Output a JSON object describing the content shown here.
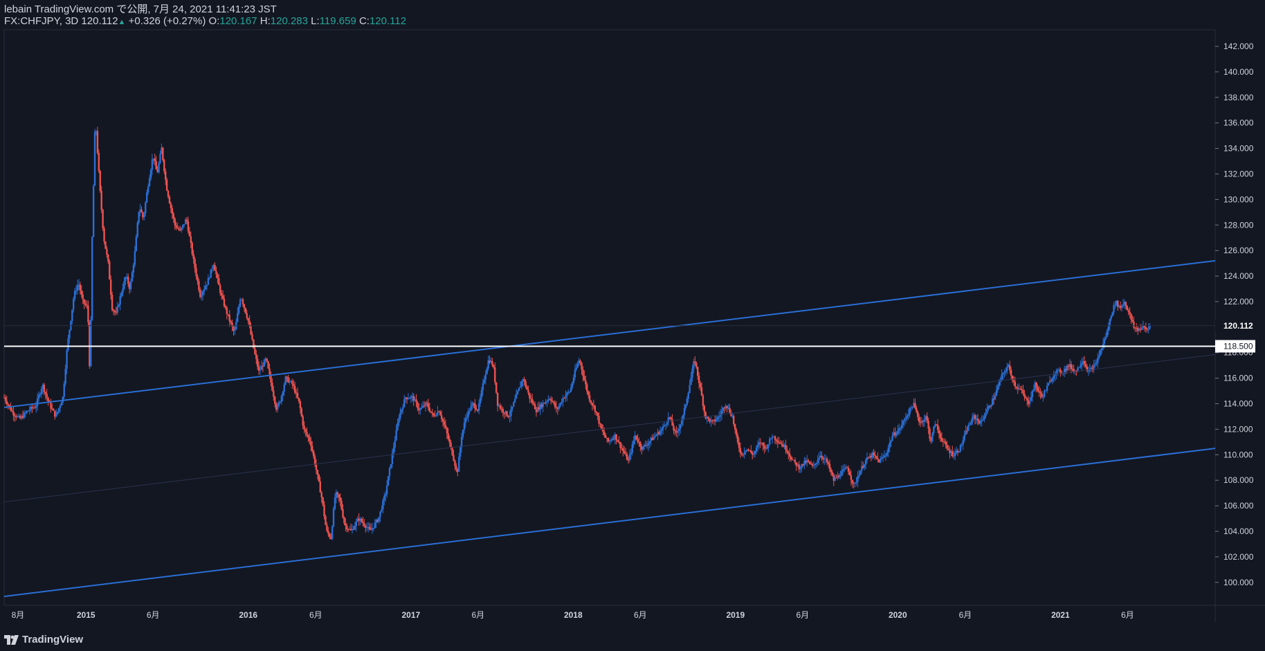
{
  "header": {
    "line1": "lebain TradingView.com で公開, 7月 24, 2021 11:41:23 JST",
    "symbol": "FX:CHFJPY, 3D",
    "last": "120.112",
    "up_arrow": "▲",
    "change": "+0.326 (+0.27%)",
    "o_label": "O:",
    "o_value": "120.167",
    "h_label": "H:",
    "h_value": "120.283",
    "l_label": "L:",
    "l_value": "119.659",
    "c_label": "C:",
    "c_value": "120.112"
  },
  "brand": {
    "name": "TradingView",
    "icon": "tradingview-logo-icon"
  },
  "colors": {
    "background": "#131722",
    "up": "#2a6fd6",
    "down": "#ef5350",
    "channel": "#2a6fd6",
    "level": "#ffffff"
  },
  "chart_data": {
    "type": "candlestick",
    "symbol": "FX:CHFJPY",
    "interval": "3D",
    "ylim": [
      98.2,
      143.3
    ],
    "y_ticks": [
      "142.000",
      "140.000",
      "138.000",
      "136.000",
      "134.000",
      "132.000",
      "130.000",
      "128.000",
      "126.000",
      "124.000",
      "122.000",
      "120.000",
      "118.000",
      "116.000",
      "114.000",
      "112.000",
      "110.000",
      "108.000",
      "106.000",
      "104.000",
      "102.000",
      "100.000"
    ],
    "x_labels": [
      "8月",
      "2015",
      "6月",
      "2016",
      "6月",
      "2017",
      "6月",
      "2018",
      "6月",
      "2019",
      "6月",
      "2020",
      "6月",
      "2021",
      "6月"
    ],
    "x_label_dates": [
      "2014-08-01",
      "2015-01-01",
      "2015-06-01",
      "2016-01-01",
      "2016-06-01",
      "2017-01-01",
      "2017-06-01",
      "2018-01-01",
      "2018-06-01",
      "2019-01-01",
      "2019-06-01",
      "2020-01-01",
      "2020-06-01",
      "2021-01-01",
      "2021-06-01"
    ],
    "x_range": [
      "2014-07-01",
      "2021-12-15"
    ],
    "close_path": [
      [
        "2014-07-01",
        114.5
      ],
      [
        "2014-07-20",
        113.3
      ],
      [
        "2014-08-05",
        112.8
      ],
      [
        "2014-08-25",
        113.5
      ],
      [
        "2014-09-10",
        113.8
      ],
      [
        "2014-09-25",
        115.5
      ],
      [
        "2014-10-10",
        114.0
      ],
      [
        "2014-10-25",
        113.0
      ],
      [
        "2014-11-10",
        114.5
      ],
      [
        "2014-11-20",
        118.5
      ],
      [
        "2014-12-05",
        122.5
      ],
      [
        "2014-12-15",
        123.5
      ],
      [
        "2014-12-25",
        122.0
      ],
      [
        "2015-01-05",
        121.5
      ],
      [
        "2015-01-10",
        116.0
      ],
      [
        "2015-01-15",
        127.0
      ],
      [
        "2015-01-22",
        136.5
      ],
      [
        "2015-02-01",
        131.0
      ],
      [
        "2015-02-10",
        127.0
      ],
      [
        "2015-02-20",
        125.0
      ],
      [
        "2015-03-01",
        121.5
      ],
      [
        "2015-03-10",
        121.0
      ],
      [
        "2015-03-20",
        122.5
      ],
      [
        "2015-04-01",
        124.0
      ],
      [
        "2015-04-10",
        123.0
      ],
      [
        "2015-04-20",
        125.5
      ],
      [
        "2015-05-01",
        129.5
      ],
      [
        "2015-05-10",
        128.5
      ],
      [
        "2015-05-20",
        131.0
      ],
      [
        "2015-06-01",
        133.5
      ],
      [
        "2015-06-10",
        132.0
      ],
      [
        "2015-06-20",
        134.0
      ],
      [
        "2015-07-01",
        131.0
      ],
      [
        "2015-07-10",
        129.5
      ],
      [
        "2015-07-20",
        128.0
      ],
      [
        "2015-08-01",
        127.5
      ],
      [
        "2015-08-15",
        128.5
      ],
      [
        "2015-09-01",
        125.0
      ],
      [
        "2015-09-15",
        122.5
      ],
      [
        "2015-10-01",
        123.5
      ],
      [
        "2015-10-15",
        125.0
      ],
      [
        "2015-11-01",
        122.5
      ],
      [
        "2015-11-15",
        121.0
      ],
      [
        "2015-12-01",
        119.5
      ],
      [
        "2015-12-15",
        122.5
      ],
      [
        "2016-01-01",
        120.5
      ],
      [
        "2016-01-15",
        118.0
      ],
      [
        "2016-01-25",
        116.5
      ],
      [
        "2016-02-10",
        117.5
      ],
      [
        "2016-02-25",
        115.0
      ],
      [
        "2016-03-05",
        113.5
      ],
      [
        "2016-03-15",
        114.5
      ],
      [
        "2016-03-25",
        116.0
      ],
      [
        "2016-04-10",
        115.5
      ],
      [
        "2016-04-25",
        114.0
      ],
      [
        "2016-05-05",
        112.0
      ],
      [
        "2016-05-20",
        111.0
      ],
      [
        "2016-06-01",
        109.0
      ],
      [
        "2016-06-15",
        106.5
      ],
      [
        "2016-06-25",
        104.0
      ],
      [
        "2016-07-05",
        103.5
      ],
      [
        "2016-07-15",
        107.0
      ],
      [
        "2016-07-25",
        106.5
      ],
      [
        "2016-08-05",
        104.5
      ],
      [
        "2016-08-20",
        104.0
      ],
      [
        "2016-09-05",
        105.0
      ],
      [
        "2016-09-20",
        104.5
      ],
      [
        "2016-10-01",
        104.0
      ],
      [
        "2016-10-20",
        105.0
      ],
      [
        "2016-11-05",
        107.0
      ],
      [
        "2016-11-20",
        110.0
      ],
      [
        "2016-12-05",
        113.0
      ],
      [
        "2016-12-20",
        114.5
      ],
      [
        "2017-01-05",
        114.5
      ],
      [
        "2017-01-20",
        113.5
      ],
      [
        "2017-02-05",
        114.0
      ],
      [
        "2017-02-20",
        113.0
      ],
      [
        "2017-03-05",
        113.5
      ],
      [
        "2017-03-20",
        112.0
      ],
      [
        "2017-04-05",
        110.0
      ],
      [
        "2017-04-15",
        108.5
      ],
      [
        "2017-04-25",
        111.5
      ],
      [
        "2017-05-05",
        113.0
      ],
      [
        "2017-05-20",
        114.0
      ],
      [
        "2017-06-01",
        113.5
      ],
      [
        "2017-06-15",
        116.0
      ],
      [
        "2017-06-25",
        117.5
      ],
      [
        "2017-07-05",
        117.0
      ],
      [
        "2017-07-15",
        114.0
      ],
      [
        "2017-07-25",
        113.5
      ],
      [
        "2017-08-10",
        113.0
      ],
      [
        "2017-08-25",
        114.5
      ],
      [
        "2017-09-10",
        116.0
      ],
      [
        "2017-09-25",
        114.5
      ],
      [
        "2017-10-10",
        113.5
      ],
      [
        "2017-10-25",
        114.0
      ],
      [
        "2017-11-10",
        114.5
      ],
      [
        "2017-11-25",
        113.5
      ],
      [
        "2017-12-10",
        114.5
      ],
      [
        "2017-12-25",
        115.0
      ],
      [
        "2018-01-05",
        116.5
      ],
      [
        "2018-01-15",
        117.5
      ],
      [
        "2018-01-25",
        116.0
      ],
      [
        "2018-02-05",
        114.5
      ],
      [
        "2018-02-20",
        113.5
      ],
      [
        "2018-03-05",
        112.0
      ],
      [
        "2018-03-20",
        111.0
      ],
      [
        "2018-04-05",
        111.5
      ],
      [
        "2018-04-20",
        110.5
      ],
      [
        "2018-05-05",
        109.5
      ],
      [
        "2018-05-20",
        111.5
      ],
      [
        "2018-06-05",
        110.5
      ],
      [
        "2018-06-20",
        111.0
      ],
      [
        "2018-07-05",
        111.5
      ],
      [
        "2018-07-20",
        112.0
      ],
      [
        "2018-08-05",
        113.0
      ],
      [
        "2018-08-20",
        111.5
      ],
      [
        "2018-09-05",
        113.0
      ],
      [
        "2018-09-20",
        115.5
      ],
      [
        "2018-10-01",
        117.5
      ],
      [
        "2018-10-15",
        115.0
      ],
      [
        "2018-10-25",
        113.0
      ],
      [
        "2018-11-10",
        112.5
      ],
      [
        "2018-11-25",
        113.0
      ],
      [
        "2018-12-10",
        114.0
      ],
      [
        "2018-12-25",
        113.0
      ],
      [
        "2019-01-05",
        111.0
      ],
      [
        "2019-01-15",
        110.0
      ],
      [
        "2019-01-25",
        110.5
      ],
      [
        "2019-02-10",
        110.0
      ],
      [
        "2019-02-25",
        111.0
      ],
      [
        "2019-03-10",
        110.5
      ],
      [
        "2019-03-25",
        111.5
      ],
      [
        "2019-04-10",
        111.0
      ],
      [
        "2019-04-25",
        110.5
      ],
      [
        "2019-05-10",
        109.5
      ],
      [
        "2019-05-25",
        109.0
      ],
      [
        "2019-06-10",
        109.5
      ],
      [
        "2019-06-25",
        109.0
      ],
      [
        "2019-07-10",
        110.0
      ],
      [
        "2019-07-25",
        109.5
      ],
      [
        "2019-08-10",
        108.0
      ],
      [
        "2019-08-25",
        108.5
      ],
      [
        "2019-09-10",
        109.0
      ],
      [
        "2019-09-25",
        107.5
      ],
      [
        "2019-10-05",
        108.5
      ],
      [
        "2019-10-20",
        109.5
      ],
      [
        "2019-11-05",
        110.0
      ],
      [
        "2019-11-20",
        109.5
      ],
      [
        "2019-12-05",
        110.0
      ],
      [
        "2019-12-20",
        111.5
      ],
      [
        "2020-01-05",
        112.0
      ],
      [
        "2020-01-20",
        113.0
      ],
      [
        "2020-02-05",
        114.0
      ],
      [
        "2020-02-20",
        112.5
      ],
      [
        "2020-03-05",
        113.0
      ],
      [
        "2020-03-15",
        111.0
      ],
      [
        "2020-03-25",
        112.5
      ],
      [
        "2020-04-05",
        111.5
      ],
      [
        "2020-04-20",
        110.5
      ],
      [
        "2020-05-05",
        110.0
      ],
      [
        "2020-05-20",
        110.5
      ],
      [
        "2020-06-05",
        112.0
      ],
      [
        "2020-06-20",
        113.0
      ],
      [
        "2020-07-05",
        112.5
      ],
      [
        "2020-07-20",
        113.5
      ],
      [
        "2020-08-05",
        114.5
      ],
      [
        "2020-08-20",
        116.0
      ],
      [
        "2020-09-05",
        117.0
      ],
      [
        "2020-09-20",
        115.5
      ],
      [
        "2020-10-05",
        115.0
      ],
      [
        "2020-10-20",
        114.0
      ],
      [
        "2020-11-05",
        115.5
      ],
      [
        "2020-11-20",
        114.5
      ],
      [
        "2020-12-05",
        115.5
      ],
      [
        "2020-12-20",
        116.5
      ],
      [
        "2021-01-05",
        116.5
      ],
      [
        "2021-01-20",
        117.0
      ],
      [
        "2021-02-05",
        116.5
      ],
      [
        "2021-02-20",
        117.5
      ],
      [
        "2021-03-05",
        116.5
      ],
      [
        "2021-03-20",
        117.0
      ],
      [
        "2021-04-05",
        118.5
      ],
      [
        "2021-04-15",
        119.5
      ],
      [
        "2021-04-25",
        121.0
      ],
      [
        "2021-05-05",
        122.0
      ],
      [
        "2021-05-15",
        121.5
      ],
      [
        "2021-05-25",
        122.0
      ],
      [
        "2021-06-05",
        121.0
      ],
      [
        "2021-06-15",
        120.0
      ],
      [
        "2021-06-25",
        119.8
      ],
      [
        "2021-07-05",
        120.0
      ],
      [
        "2021-07-15",
        119.8
      ],
      [
        "2021-07-23",
        120.112
      ]
    ],
    "horizontal_level": {
      "value": 118.5,
      "label": "118.500"
    },
    "last_price": {
      "value": 120.112,
      "label": "120.112"
    },
    "channel_upper": [
      [
        "2014-07-01",
        113.7
      ],
      [
        "2021-12-15",
        125.2
      ]
    ],
    "channel_lower": [
      [
        "2014-07-01",
        98.9
      ],
      [
        "2021-12-15",
        110.5
      ]
    ],
    "channel_mid": [
      [
        "2014-07-01",
        106.3
      ],
      [
        "2021-12-15",
        117.85
      ]
    ]
  }
}
